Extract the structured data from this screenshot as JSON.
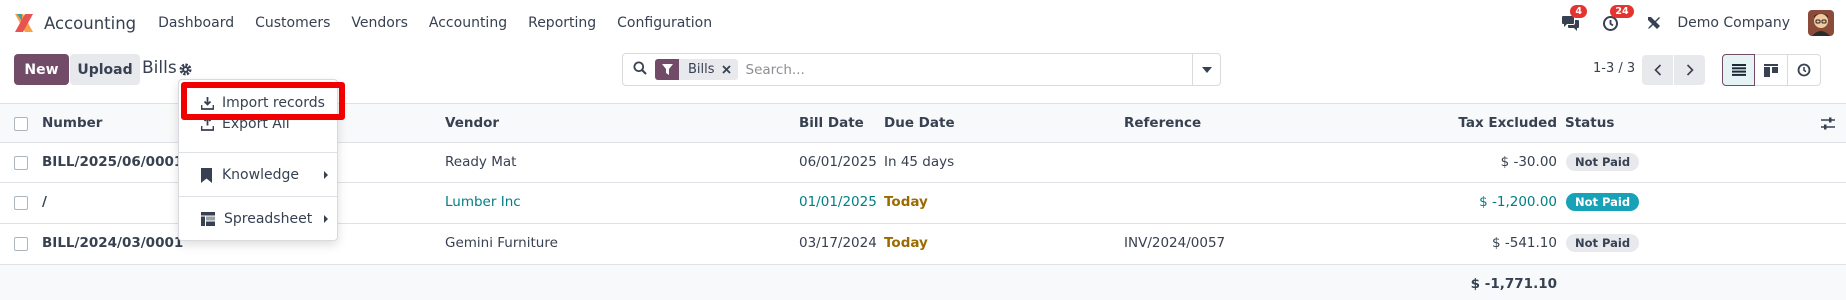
{
  "navbar": {
    "app_name": "Accounting",
    "menu": [
      "Dashboard",
      "Customers",
      "Vendors",
      "Accounting",
      "Reporting",
      "Configuration"
    ],
    "messages_badge": "4",
    "activities_badge": "24",
    "company": "Demo Company"
  },
  "control_panel": {
    "new_label": "New",
    "upload_label": "Upload",
    "breadcrumb": "Bills",
    "search": {
      "facet": "Bills",
      "placeholder": "Search..."
    },
    "pager": "1-3 / 3"
  },
  "gear_menu": {
    "items": [
      "Import records",
      "Export All",
      "Knowledge",
      "Spreadsheet"
    ]
  },
  "table": {
    "headers": {
      "number": "Number",
      "vendor": "Vendor",
      "bill_date": "Bill Date",
      "due_date": "Due Date",
      "reference": "Reference",
      "tax_excluded": "Tax Excluded",
      "status": "Status"
    },
    "rows": [
      {
        "number": "BILL/2025/06/0001",
        "vendor": "Ready Mat",
        "bill_date": "06/01/2025",
        "due_date": "In 45 days",
        "reference": "",
        "tax_excluded": "$ -30.00",
        "status": "Not Paid"
      },
      {
        "number": "/",
        "vendor": "Lumber Inc",
        "bill_date": "01/01/2025",
        "due_date": "Today",
        "reference": "",
        "tax_excluded": "$ -1,200.00",
        "status": "Not Paid"
      },
      {
        "number": "BILL/2024/03/0001",
        "vendor": "Gemini Furniture",
        "bill_date": "03/17/2024",
        "due_date": "Today",
        "reference": "INV/2024/0057",
        "tax_excluded": "$ -541.10",
        "status": "Not Paid"
      }
    ],
    "total_tax_excluded": "$ -1,771.10"
  },
  "colors": {
    "primary": "#714b67",
    "teal": "#017e84",
    "warning": "#9a6b01",
    "highlight": "#f00000",
    "badge_red": "#e3342f"
  },
  "icons": [
    "odoo-accounting-logo",
    "chat-icon",
    "activity-clock-icon",
    "tools-icon",
    "gear-icon",
    "search-icon",
    "filter-icon",
    "close-icon",
    "caret-down-icon",
    "chevron-left-icon",
    "chevron-right-icon",
    "list-view-icon",
    "kanban-view-icon",
    "activity-view-icon",
    "optional-columns-icon",
    "download-icon",
    "upload-icon",
    "bookmark-icon",
    "spreadsheet-icon"
  ]
}
